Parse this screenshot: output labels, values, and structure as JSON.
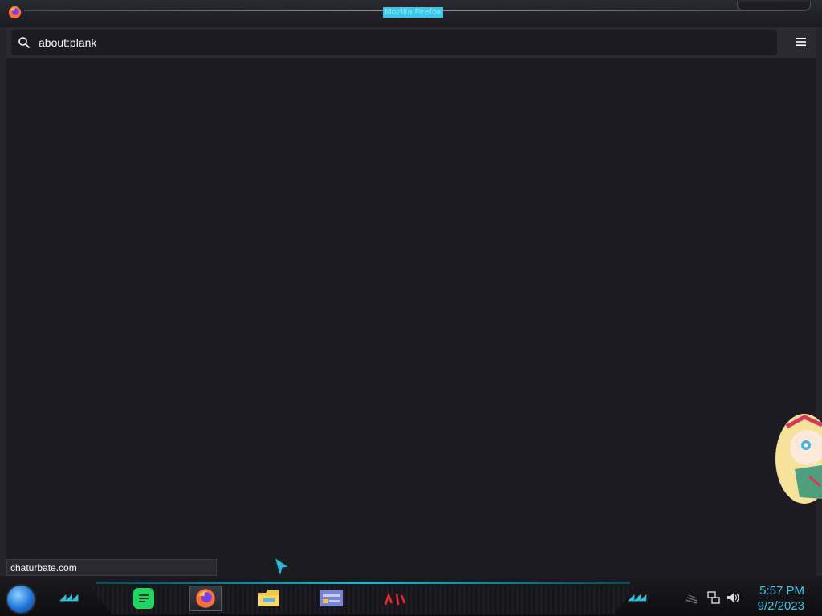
{
  "window": {
    "title": "Mozilla Firefox",
    "app_icon": "firefox-icon"
  },
  "toolbar": {
    "url": "about:blank",
    "search_icon": "search-icon",
    "menu_icon": "hamburger-menu-icon"
  },
  "status_link": "chaturbate.com",
  "taskbar": {
    "start_icon": "start-orb-icon",
    "apps": [
      {
        "name": "Spotify",
        "icon": "spotify-icon"
      },
      {
        "name": "Firefox",
        "icon": "firefox-icon",
        "active": true
      },
      {
        "name": "File Explorer",
        "icon": "folder-icon"
      },
      {
        "name": "Control Panel",
        "icon": "control-panel-icon"
      },
      {
        "name": "Media App",
        "icon": "media-app-icon"
      }
    ],
    "tray_icons": [
      "network-icon",
      "volume-icon"
    ],
    "clock_time": "5:57 PM",
    "clock_date": "9/2/2023"
  },
  "colors": {
    "accent": "#33cbe8",
    "content_bg": "#1c1b22",
    "toolbar_bg": "#2b2a33"
  }
}
